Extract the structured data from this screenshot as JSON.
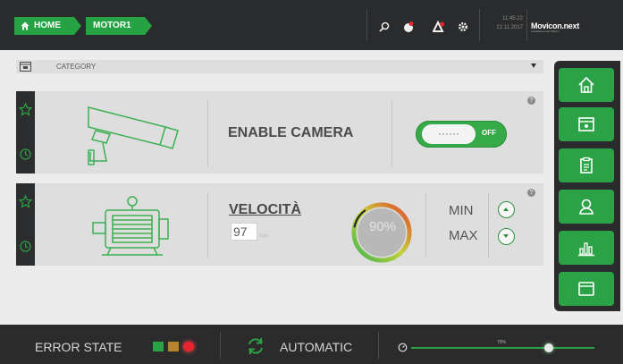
{
  "breadcrumb": {
    "home": "HOME",
    "current": "MOTOR1"
  },
  "topbar": {
    "icons": [
      "search-icon",
      "alarm-icon",
      "warning-icon",
      "gear-icon"
    ],
    "time": "11:45:22",
    "date": "22.11.2017",
    "brand": "Movicon.next",
    "brand_sub": "Industrial Automation Platform"
  },
  "category": {
    "label": "CATEGORY"
  },
  "camera_card": {
    "title": "ENABLE CAMERA",
    "toggle_state": "OFF",
    "help": "?"
  },
  "motor_card": {
    "title": "VELOCITÀ",
    "value": "97",
    "unit": "Rpm",
    "gauge_value": "90%",
    "gauge_fraction": 0.9,
    "min_label": "MIN",
    "max_label": "MAX",
    "help": "?"
  },
  "rightnav": {
    "buttons": [
      "home-icon",
      "panel-icon",
      "clipboard-icon",
      "user-icon",
      "chart-icon",
      "window-icon"
    ]
  },
  "status": {
    "error_label": "ERROR STATE",
    "mode_label": "AUTOMATIC",
    "slider_label": "70%",
    "slider_fraction": 0.75,
    "colors": {
      "accent": "#2ba245",
      "error": "#e8252f",
      "amber": "#b5862b"
    }
  }
}
